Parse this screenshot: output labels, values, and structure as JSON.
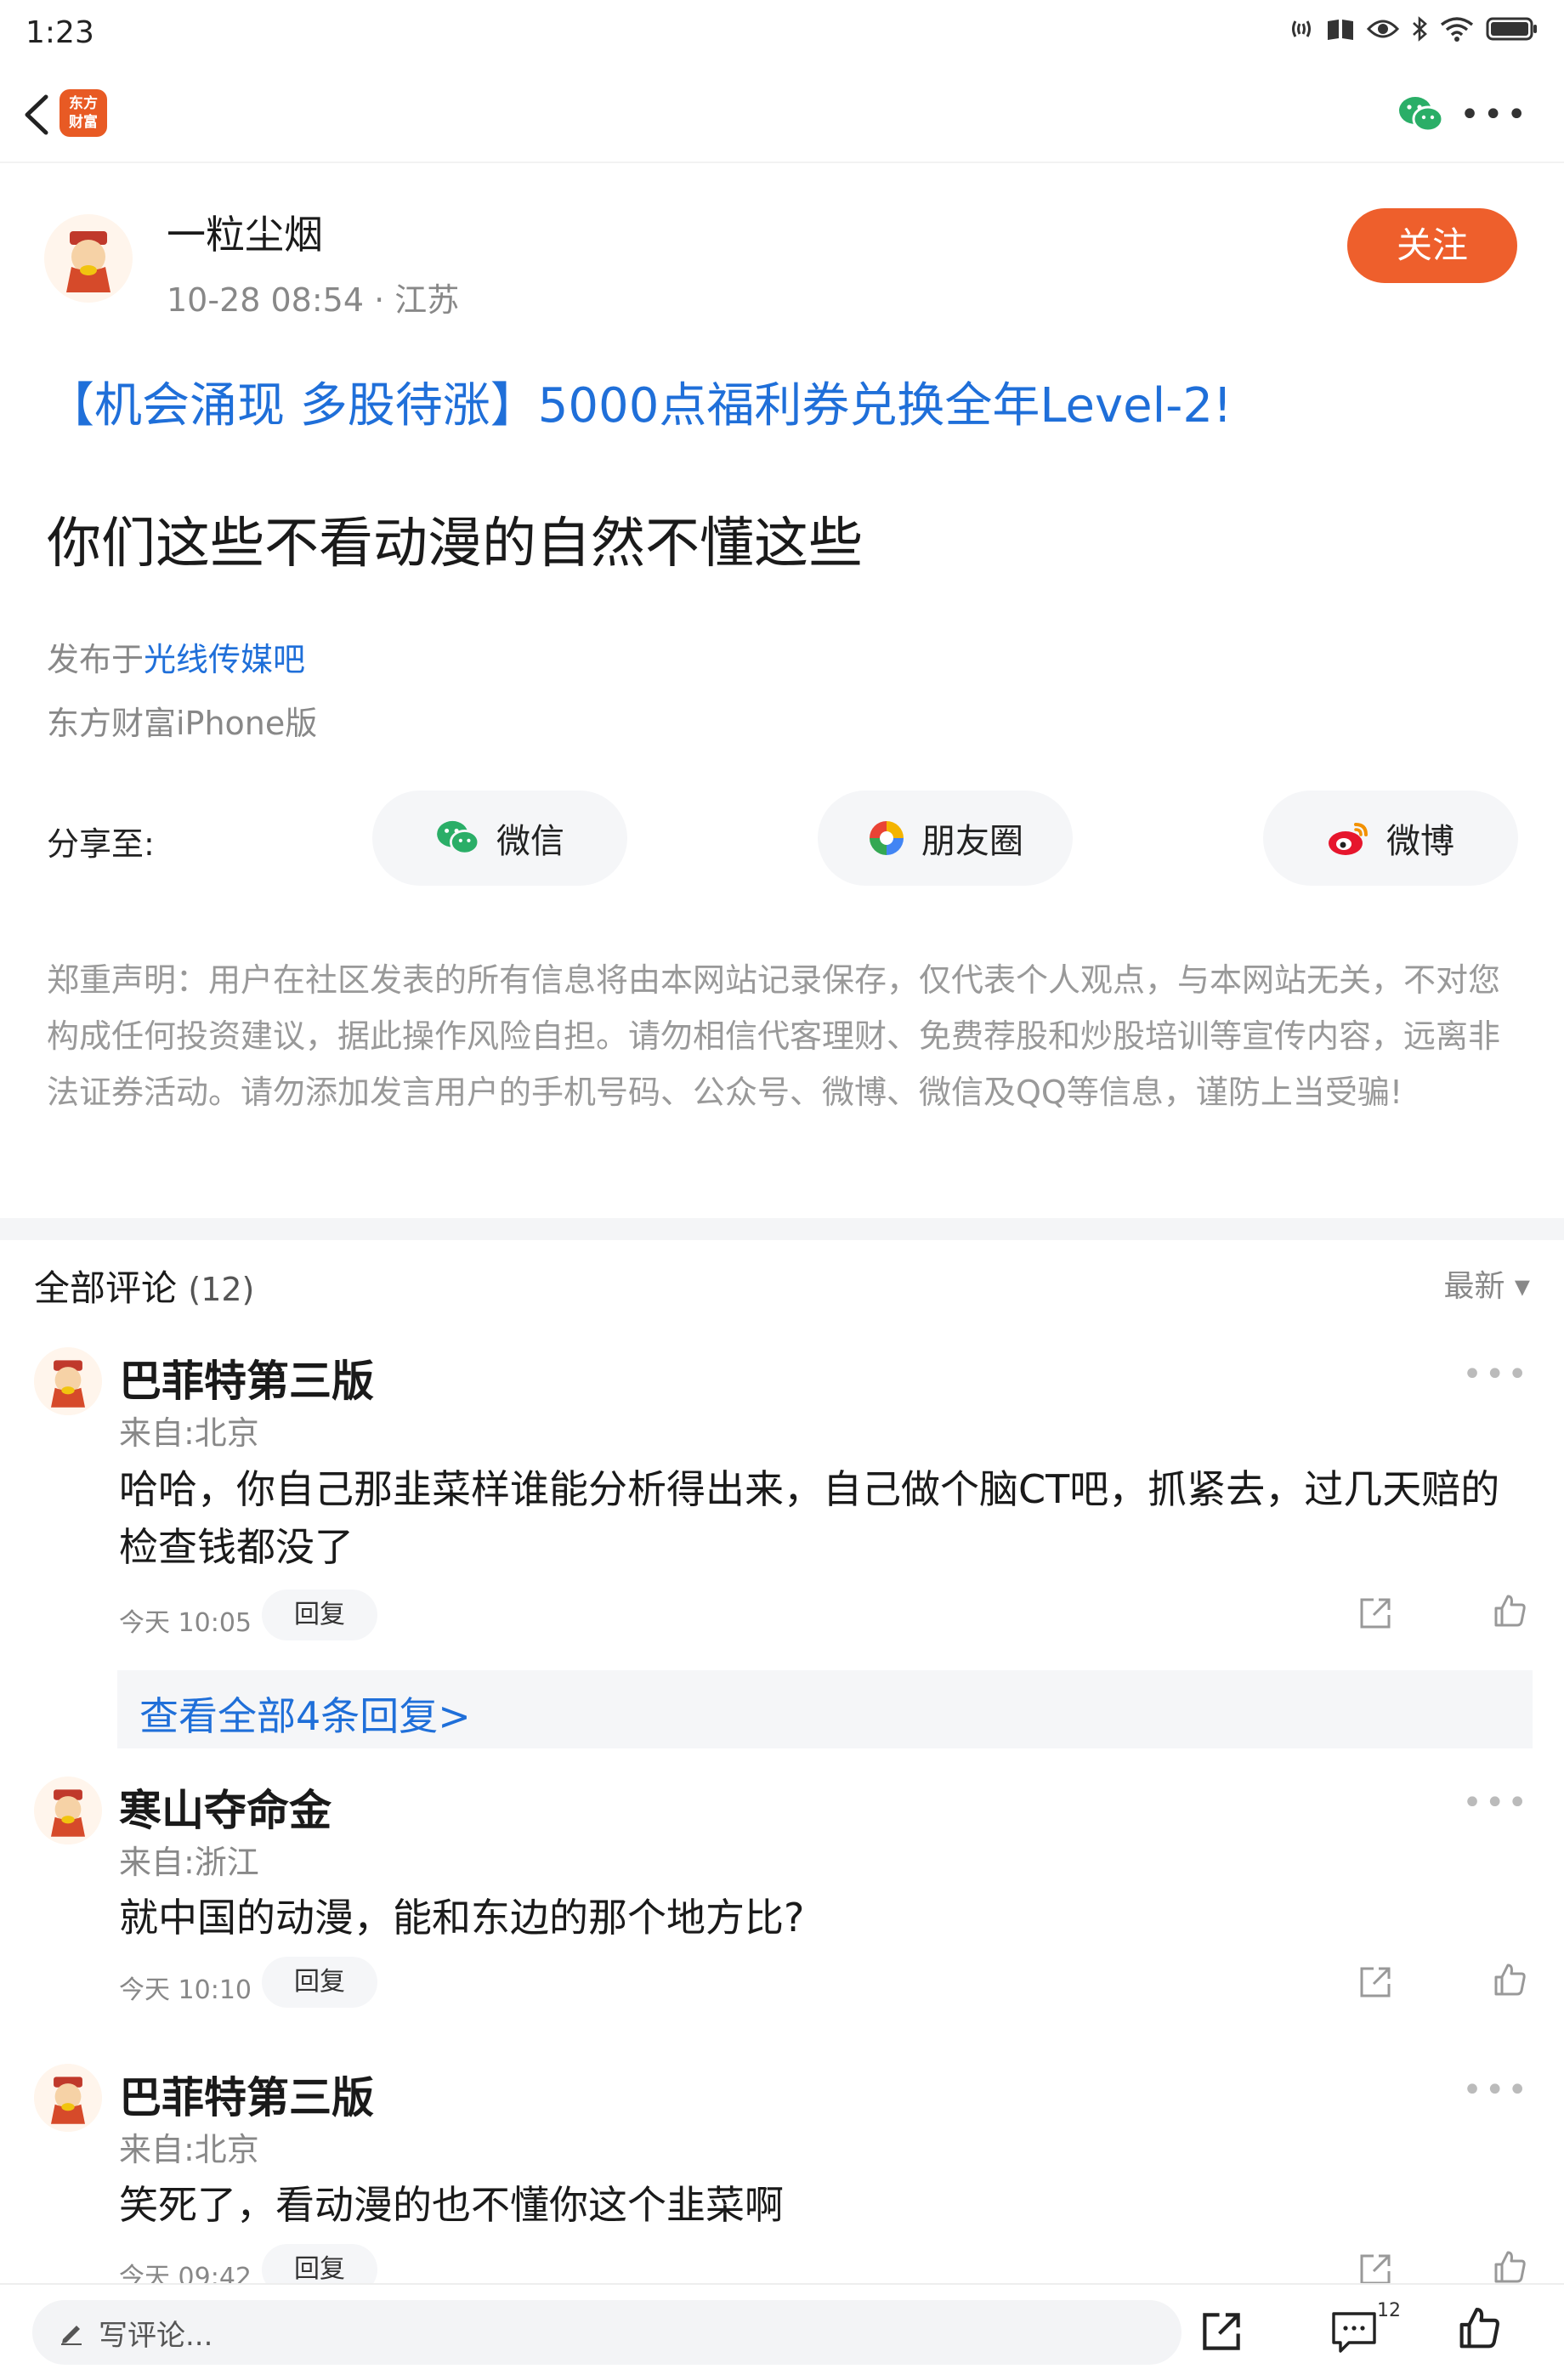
{
  "status_bar": {
    "time": "1:23"
  },
  "app": {
    "logo_text": "东方财富"
  },
  "author": {
    "name": "一粒尘烟",
    "time": "10-28 08:54",
    "location": "江苏",
    "separator": " · "
  },
  "follow_label": "关注",
  "promo_text": "【机会涌现 多股待涨】5000点福利券兑换全年Level-2!",
  "post_title": "你们这些不看动漫的自然不懂这些",
  "posted_in": {
    "prefix": "发布于",
    "bar_name": "光线传媒吧"
  },
  "client": "东方财富iPhone版",
  "share": {
    "label": "分享至:",
    "wechat": "微信",
    "moments": "朋友圈",
    "weibo": "微博"
  },
  "disclaimer": "郑重声明：用户在社区发表的所有信息将由本网站记录保存，仅代表个人观点，与本网站无关，不对您构成任何投资建议，据此操作风险自担。请勿相信代客理财、免费荐股和炒股培训等宣传内容，远离非法证券活动。请勿添加发言用户的手机号码、公众号、微博、微信及QQ等信息，谨防上当受骗!",
  "comments_header": {
    "title": "全部评论",
    "count": "(12)",
    "sort_label": "最新 ▾"
  },
  "comments": [
    {
      "name": "巴菲特第三版",
      "from": "来自:北京",
      "text": "哈哈，你自己那韭菜样谁能分析得出来，自己做个脑CT吧，抓紧去，过几天赔的检查钱都没了",
      "time": "今天 10:05",
      "reply_label": "回复",
      "view_replies": "查看全部4条回复>"
    },
    {
      "name": "寒山夺命金",
      "from": "来自:浙江",
      "text": "就中国的动漫，能和东边的那个地方比?",
      "time": "今天 10:10",
      "reply_label": "回复"
    },
    {
      "name": "巴菲特第三版",
      "from": "来自:北京",
      "text": "笑死了，看动漫的也不懂你这个韭菜啊",
      "time": "今天 09:42",
      "reply_label": "回复"
    }
  ],
  "bottom_bar": {
    "input_placeholder": "写评论...",
    "comment_count": "12"
  },
  "icons": [
    "back-icon",
    "wechat-icon",
    "more-icon",
    "moments-icon",
    "weibo-icon",
    "share-icon",
    "like-icon",
    "comment-icon",
    "pencil-icon"
  ],
  "colors": {
    "accent_orange": "#ee5f2c",
    "link_blue": "#1f6fd9",
    "wechat_green": "#2aae67"
  }
}
